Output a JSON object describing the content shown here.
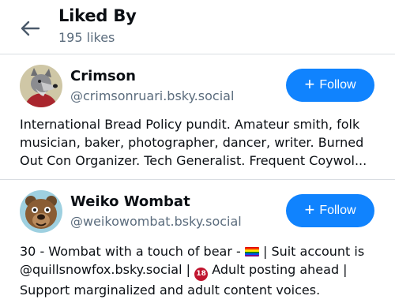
{
  "header": {
    "title": "Liked By",
    "count_label": "195 likes"
  },
  "colors": {
    "accent": "#1083fe",
    "muted_text": "#5b6c7d",
    "divider": "#d9dde2"
  },
  "users": [
    {
      "name": "Crimson",
      "handle": "@crimsonruari.bsky.social",
      "follow_label": "Follow",
      "avatar_icon": "wolf-avatar-icon",
      "bio": "International Bread Policy pundit. Amateur smith, folk musician, baker, photographer, dancer, writer. Burned Out Con Organizer. Tech Generalist. Frequent Coywol..."
    },
    {
      "name": "Weiko Wombat",
      "handle": "@weikowombat.bsky.social",
      "follow_label": "Follow",
      "avatar_icon": "wombat-avatar-icon",
      "bio_part1": "30 - Wombat with a touch of bear - ",
      "bio_part2": " | Suit account is @quillsnowfox.bsky.social | ",
      "bio_badge": "18",
      "bio_part3": " Adult posting ahead | Support marginalized and adult content voices."
    }
  ]
}
